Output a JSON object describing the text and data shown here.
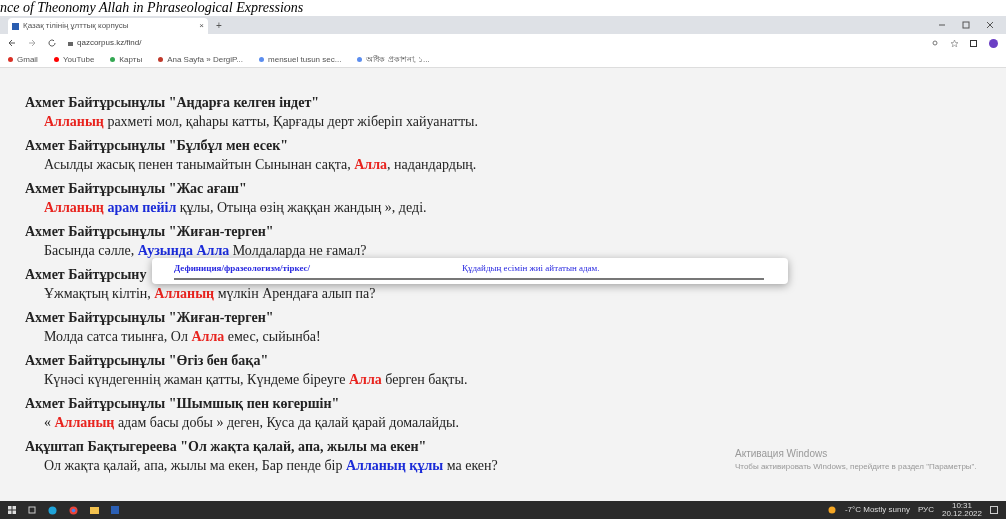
{
  "caption": "nce of Theonomy Allah in Phraseological Expressions",
  "browser": {
    "tab_title": "Қазақ тілінің ұлттық корпусы",
    "tab_close": "×",
    "new_tab": "+",
    "url": "qazcorpus.kz/find/",
    "bookmarks": [
      {
        "label": "Gmail",
        "color": "#d93025"
      },
      {
        "label": "YouTube",
        "color": "#ff0000"
      },
      {
        "label": "Карты",
        "color": "#34a853"
      },
      {
        "label": "Ana Sayfa » DergiP...",
        "color": "#c0392b"
      },
      {
        "label": "mensuel tusun sec...",
        "color": "#5b8def"
      },
      {
        "label": "অধিক প্রকাশনা, ১...",
        "color": "#5b8def"
      }
    ]
  },
  "entries": [
    {
      "title": "Ахмет Байтұрсынұлы \"Аңдарға келген індет\"",
      "line": [
        {
          "text": "Алланың",
          "kind": "red"
        },
        {
          "text": " рахметі мол, қаһары катты, Қарғады дерт жіберіп хайуанатты.",
          "kind": "plain"
        }
      ]
    },
    {
      "title": "Ахмет Байтұрсынұлы \"Бұлбұл мен есек\"",
      "line": [
        {
          "text": "Асылды жасық пенен танымайтын Сынынан сақта, ",
          "kind": "plain"
        },
        {
          "text": "Алла",
          "kind": "red"
        },
        {
          "text": ", надандардың.",
          "kind": "plain"
        }
      ]
    },
    {
      "title": "Ахмет Байтұрсынұлы \"Жас ағаш\"",
      "line": [
        {
          "text": "Алланың",
          "kind": "red"
        },
        {
          "text": " арам пейіл",
          "kind": "blue"
        },
        {
          "text": " құлы, Отыңа өзің жаққан жандың », деді.",
          "kind": "plain"
        }
      ]
    },
    {
      "title": "Ахмет Байтұрсынұлы \"Жиған-терген\"",
      "line": [
        {
          "text": "Басында сәлле, ",
          "kind": "plain"
        },
        {
          "text": "Аузында Алла",
          "kind": "blue"
        },
        {
          "text": " Молдаларда не ғамал?",
          "kind": "plain"
        }
      ]
    },
    {
      "title": "Ахмет Байтұрсыну",
      "line": [
        {
          "text": "Ұжмақтың кілтін, ",
          "kind": "plain"
        },
        {
          "text": "Алланың",
          "kind": "red"
        },
        {
          "text": " мүлкін Арендаға алып па?",
          "kind": "plain"
        }
      ]
    },
    {
      "title": "Ахмет Байтұрсынұлы \"Жиған-терген\"",
      "line": [
        {
          "text": "Молда сатса тиынға, Ол ",
          "kind": "plain"
        },
        {
          "text": "Алла",
          "kind": "red"
        },
        {
          "text": " емес, сыйынба!",
          "kind": "plain"
        }
      ]
    },
    {
      "title": "Ахмет Байтұрсынұлы \"Өгіз бен бақа\"",
      "line": [
        {
          "text": "Күнәсі күндегеннің жаман қатты, Күндеме біреуге ",
          "kind": "plain"
        },
        {
          "text": "Алла",
          "kind": "red"
        },
        {
          "text": " берген бақты.",
          "kind": "plain"
        }
      ]
    },
    {
      "title": "Ахмет Байтұрсынұлы \"Шымшық пен көгершін\"",
      "line": [
        {
          "text": "« ",
          "kind": "plain"
        },
        {
          "text": "Алланың",
          "kind": "red"
        },
        {
          "text": " адам басы добы » деген, Куса да қалай қарай домалайды.",
          "kind": "plain"
        }
      ]
    },
    {
      "title": "Ақұштап Бақтыгереева \"Ол жақта қалай, апа, жылы ма екен\"",
      "line": [
        {
          "text": "Ол жақта қалай, апа, жылы ма екен, Бар пенде бір ",
          "kind": "plain"
        },
        {
          "text": "Алланың құлы",
          "kind": "blue"
        },
        {
          "text": " ма екен?",
          "kind": "plain"
        }
      ]
    }
  ],
  "popup": {
    "term": "Дефиниция/фразеологизм/тіркес/",
    "definition": "Құдайдың есімін жиі айтатын адам."
  },
  "activation": {
    "title": "Активация Windows",
    "text": "Чтобы активировать Windows, перейдите в раздел \"Параметры\"."
  },
  "taskbar": {
    "weather": "-7°C  Mostly sunny",
    "language": "РУС",
    "time": "10:31",
    "date": "20.12.2022"
  }
}
